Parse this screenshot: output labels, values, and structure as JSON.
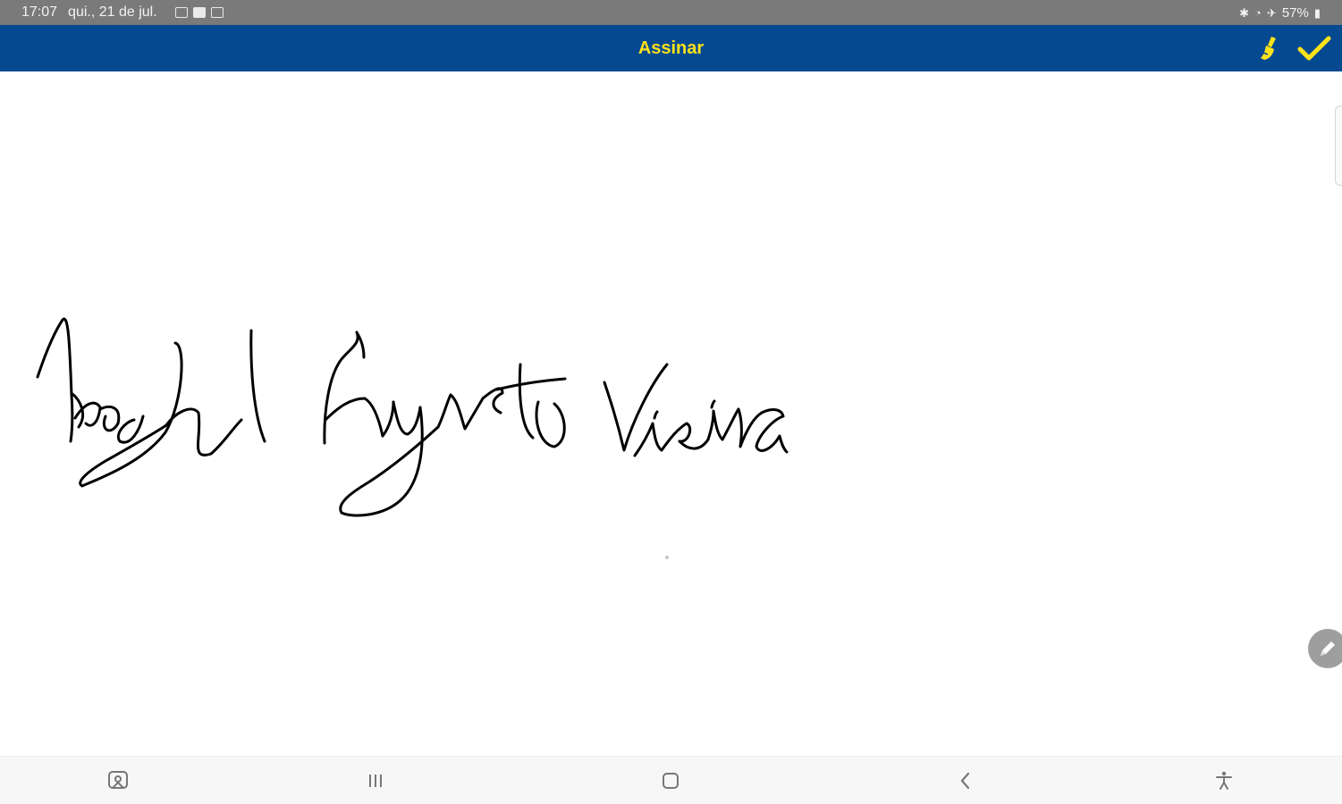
{
  "status_bar": {
    "time": "17:07",
    "date": "qui., 21 de jul.",
    "battery": "57%"
  },
  "app_bar": {
    "title": "Assinar",
    "clear_icon": "broom-icon",
    "confirm_icon": "checkmark-icon"
  },
  "signature": {
    "description_icon": "handwritten-signature"
  },
  "colors": {
    "app_bar_bg": "#054a91",
    "title_accent": "#ffe21a",
    "status_bar_bg": "#7a7a7a",
    "ink": "#000000"
  },
  "nav_bar": {
    "icons": [
      "screenshot-icon",
      "recents-icon",
      "home-icon",
      "back-icon",
      "accessibility-icon"
    ]
  }
}
